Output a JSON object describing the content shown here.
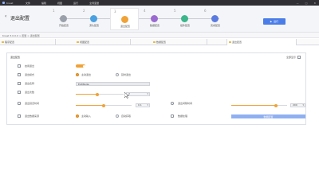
{
  "app": {
    "name": "Knest",
    "title": "退出配置"
  },
  "menu": [
    "文件",
    "编辑",
    "视图",
    "运行",
    "全局变量"
  ],
  "window_controls": [
    "—",
    "□",
    "✕"
  ],
  "steps": [
    {
      "num": "1",
      "label": "开始配置",
      "color": "#9aa0aa",
      "active": false
    },
    {
      "num": "2",
      "label": "源头配置",
      "color": "#4aa0e0",
      "active": false
    },
    {
      "num": "3",
      "label": "退出配置",
      "color": "#f0a237",
      "active": true
    },
    {
      "num": "4",
      "label": "数据配置",
      "color": "#9a6ad0",
      "active": false
    },
    {
      "num": "5",
      "label": "组件配置",
      "color": "#3bb58a",
      "active": false
    },
    {
      "num": "6",
      "label": "完成配置",
      "color": "#5a7ae0",
      "active": false
    }
  ],
  "toolbar": {
    "run_label": "运行"
  },
  "breadcrumb": "Knest 3.0.0.0 > 配置 > 退出配置",
  "tabs": [
    "程序配置",
    "视图配置",
    "数据配置",
    "退出配置"
  ],
  "panel": {
    "title": "退出配置",
    "show_all": "全部显示",
    "rows": {
      "enable_label": "启用退出",
      "mode_label": "退出模式",
      "mode_opt1": "主动退出",
      "mode_opt2": "延时退出",
      "name_label": "退出名称",
      "name_value": "ExitNode",
      "count_label": "退出次数",
      "count_value": "2",
      "delay_label": "退出延迟时间",
      "delay_value": "0.1",
      "interval_label": "退出间隔时间",
      "interval_value": "200",
      "source_label": "退出数据来源",
      "src_opt1": "主动输入",
      "src_opt2": "自动获取",
      "extra_label": "数据处理",
      "extra_button": "数据配置"
    },
    "values": {
      "count_level": 0.45,
      "delay_level": 0.5,
      "interval_level": 0.8
    }
  }
}
